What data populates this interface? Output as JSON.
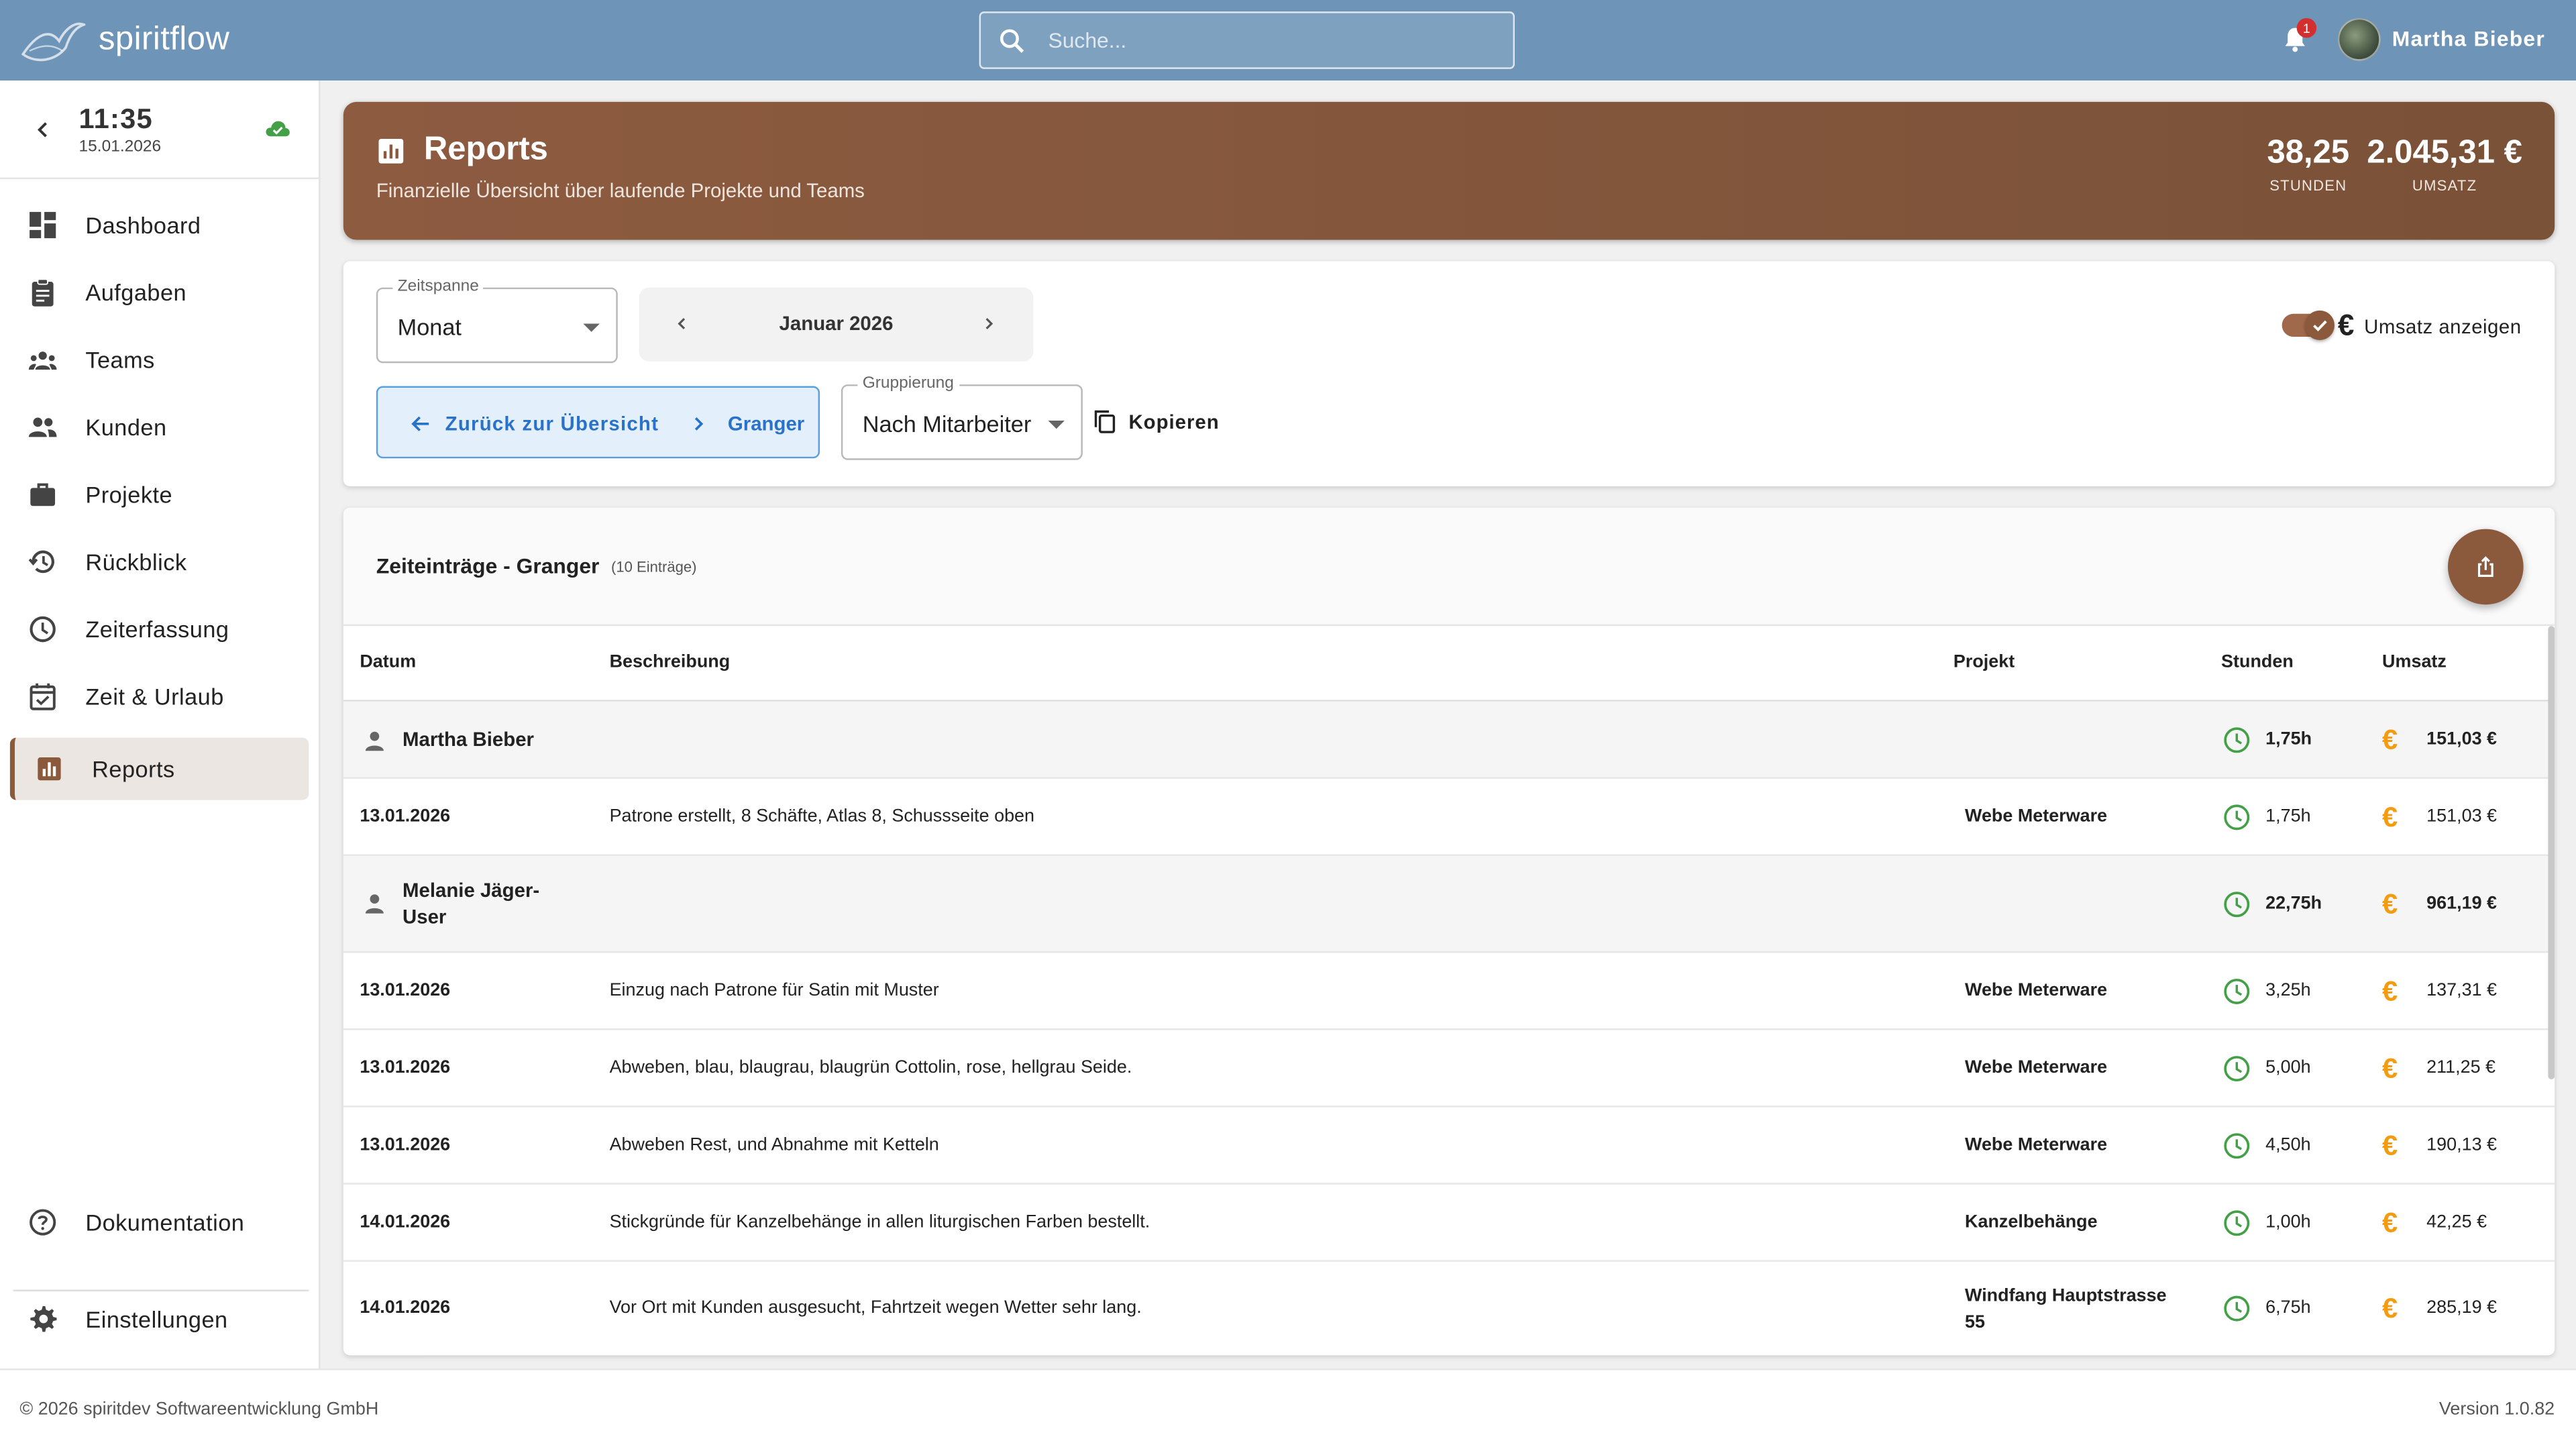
{
  "app": {
    "name": "spiritflow"
  },
  "search": {
    "placeholder": "Suche..."
  },
  "notifications": {
    "count": "1"
  },
  "user": {
    "name": "Martha Bieber"
  },
  "clock": {
    "time": "11:35",
    "date": "15.01.2026"
  },
  "sidebar": {
    "items": [
      {
        "label": "Dashboard",
        "icon": "dashboard-icon"
      },
      {
        "label": "Aufgaben",
        "icon": "clipboard-icon"
      },
      {
        "label": "Teams",
        "icon": "groups-icon"
      },
      {
        "label": "Kunden",
        "icon": "people-icon"
      },
      {
        "label": "Projekte",
        "icon": "briefcase-icon"
      },
      {
        "label": "Rückblick",
        "icon": "history-icon"
      },
      {
        "label": "Zeiterfassung",
        "icon": "clock-icon"
      },
      {
        "label": "Zeit & Urlaub",
        "icon": "calendar-check-icon"
      },
      {
        "label": "Reports",
        "icon": "bar-chart-icon",
        "active": true
      }
    ],
    "bottom": [
      {
        "label": "Dokumentation",
        "icon": "help-icon"
      },
      {
        "label": "Einstellungen",
        "icon": "gear-icon"
      }
    ]
  },
  "header": {
    "title": "Reports",
    "subtitle": "Finanzielle Übersicht über laufende Projekte und Teams",
    "hours_value": "38,25",
    "hours_label": "STUNDEN",
    "revenue_value": "2.045,31 €",
    "revenue_label": "UMSATZ"
  },
  "filters": {
    "period_label": "Zeitspanne",
    "period_value": "Monat",
    "month": "Januar 2026",
    "back_label": "Zurück zur Übersicht",
    "breadcrumb": "Granger",
    "grouping_label": "Gruppierung",
    "grouping_value": "Nach Mitarbeiter",
    "copy_label": "Kopieren",
    "show_revenue_label": "Umsatz anzeigen",
    "show_revenue": true
  },
  "table": {
    "title": "Zeiteinträge - Granger",
    "count": "(10 Einträge)",
    "columns": [
      "Datum",
      "Beschreibung",
      "Projekt",
      "Stunden",
      "Umsatz"
    ],
    "groups": [
      {
        "name": "Martha Bieber",
        "hours": "1,75h",
        "revenue": "151,03 €",
        "rows": [
          {
            "date": "13.01.2026",
            "desc": "Patrone erstellt, 8 Schäfte, Atlas 8, Schussseite oben",
            "project": "Webe Meterware",
            "hours": "1,75h",
            "revenue": "151,03 €"
          }
        ]
      },
      {
        "name": "Melanie Jäger-User",
        "hours": "22,75h",
        "revenue": "961,19 €",
        "rows": [
          {
            "date": "13.01.2026",
            "desc": "Einzug nach Patrone für Satin mit Muster",
            "project": "Webe Meterware",
            "hours": "3,25h",
            "revenue": "137,31 €"
          },
          {
            "date": "13.01.2026",
            "desc": "Abweben, blau, blaugrau, blaugrün Cottolin, rose, hellgrau Seide.",
            "project": "Webe Meterware",
            "hours": "5,00h",
            "revenue": "211,25 €"
          },
          {
            "date": "13.01.2026",
            "desc": "Abweben Rest, und Abnahme mit Ketteln",
            "project": "Webe Meterware",
            "hours": "4,50h",
            "revenue": "190,13 €"
          },
          {
            "date": "14.01.2026",
            "desc": "Stickgründe für Kanzelbehänge in allen liturgischen Farben bestellt.",
            "project": "Kanzelbehänge",
            "hours": "1,00h",
            "revenue": "42,25 €"
          },
          {
            "date": "14.01.2026",
            "desc": "Vor Ort mit Kunden ausgesucht, Fahrtzeit wegen Wetter sehr lang.",
            "project": "Windfang Hauptstrasse 55",
            "hours": "6,75h",
            "revenue": "285,19 €"
          }
        ]
      }
    ]
  },
  "footer": {
    "copyright": "© 2026 spiritdev Softwareentwicklung GmbH",
    "version": "Version 1.0.82"
  },
  "colors": {
    "topbar": "#6e95b8",
    "accent_brown": "#8b5a3c",
    "link_blue": "#2a72c9",
    "clock_green": "#43a047",
    "euro_orange": "#f39c12"
  }
}
